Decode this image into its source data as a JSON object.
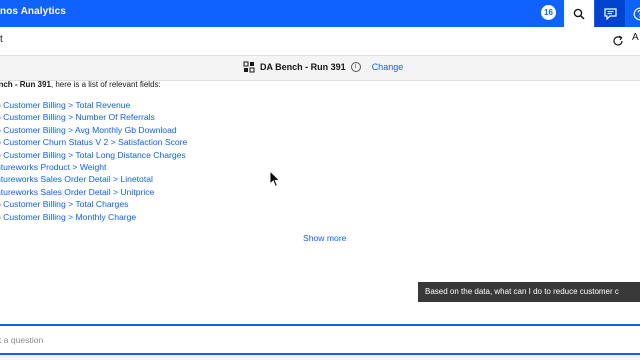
{
  "header": {
    "app_title": "nos Analytics",
    "badge_count": "16",
    "icons": [
      "search-icon",
      "chat-icon",
      "help-icon"
    ]
  },
  "subbar": {
    "left_text": "t",
    "right_text": "A"
  },
  "context": {
    "name": "DA Bench - Run 391",
    "info_symbol": "i",
    "change_label": "Change"
  },
  "content": {
    "intro_bold": "ench - Run 391",
    "intro_rest": ", here is a list of relevant fields:",
    "fields": [
      "o Customer Billing > Total Revenue",
      "o Customer Billing > Number Of Referrals",
      "o Customer Billing > Avg Monthly Gb Download",
      "o Customer Churn Status V 2 > Satisfaction Score",
      "o Customer Billing > Total Long Distance Charges",
      "ntureworks Product > Weight",
      "ntureworks Sales Order Detail > Linetotal",
      "ntureworks Sales Order Detail > Unitprice",
      "o Customer Billing > Total Charges",
      "o Customer Billing > Monthly Charge"
    ],
    "show_more": "Show more"
  },
  "tooltip": {
    "text": "Based on the data, what can I do to reduce customer c"
  },
  "input": {
    "placeholder": "k a question"
  },
  "colors": {
    "brand_blue": "#0f62fe",
    "active_blue": "#0043ce",
    "tooltip_bg": "#393939"
  }
}
